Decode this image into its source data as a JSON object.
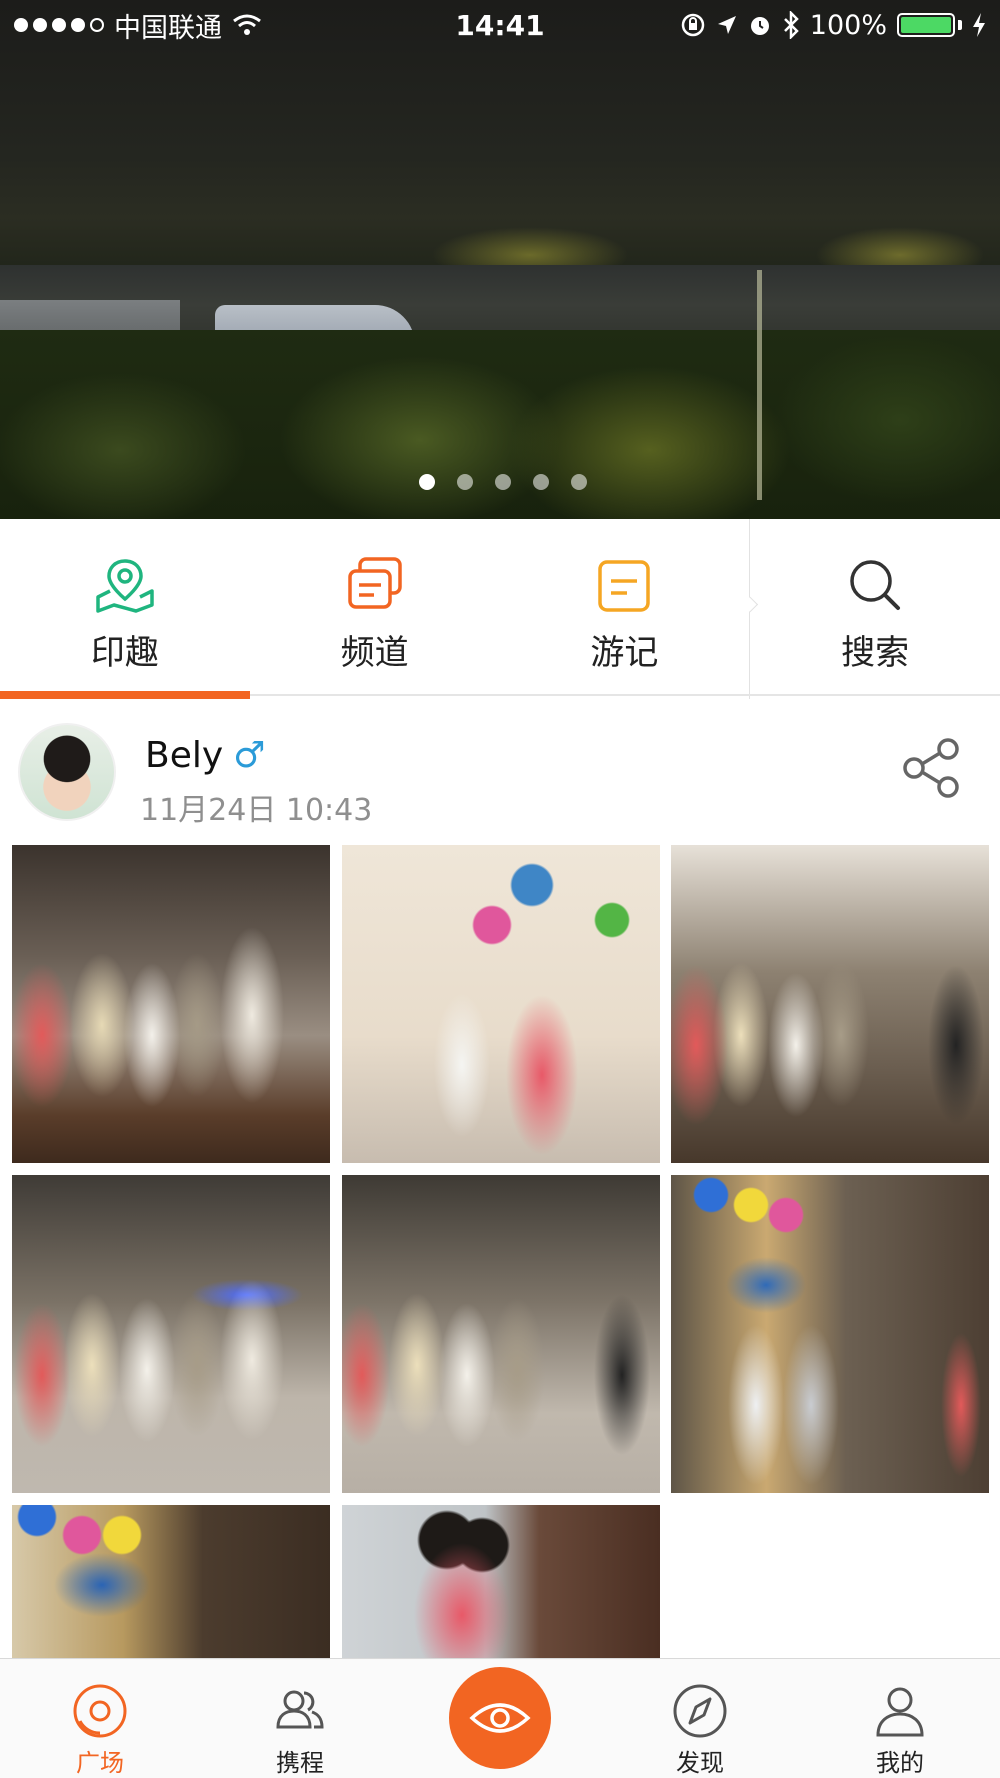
{
  "status_bar": {
    "carrier": "中国联通",
    "time": "14:41",
    "battery_percent": "100%",
    "signal_bars_filled": 4,
    "signal_bars_total": 5
  },
  "banner": {
    "slide_count": 5,
    "active_slide": 1
  },
  "nav_tiles": [
    {
      "label": "印趣",
      "icon": "map-pin-icon",
      "color": "#1fb57f"
    },
    {
      "label": "频道",
      "icon": "channel-cards-icon",
      "color": "#f26522"
    },
    {
      "label": "游记",
      "icon": "travel-notes-icon",
      "color": "#f5a623"
    },
    {
      "label": "搜索",
      "icon": "search-icon",
      "color": "#333333"
    }
  ],
  "post": {
    "username": "Bely",
    "gender_symbol": "♂",
    "timestamp": "11月24日 10:43",
    "photo_count": 8
  },
  "tab_bar": {
    "items": [
      {
        "label": "广场",
        "icon": "plaza-icon",
        "active": true
      },
      {
        "label": "携程",
        "icon": "group-icon",
        "active": false
      },
      {
        "label": "",
        "icon": "eye-icon",
        "active": false
      },
      {
        "label": "发现",
        "icon": "compass-icon",
        "active": false
      },
      {
        "label": "我的",
        "icon": "profile-icon",
        "active": false
      }
    ]
  },
  "colors": {
    "accent": "#f26522",
    "male_blue": "#2b9bd8",
    "battery_green": "#4cd964"
  }
}
